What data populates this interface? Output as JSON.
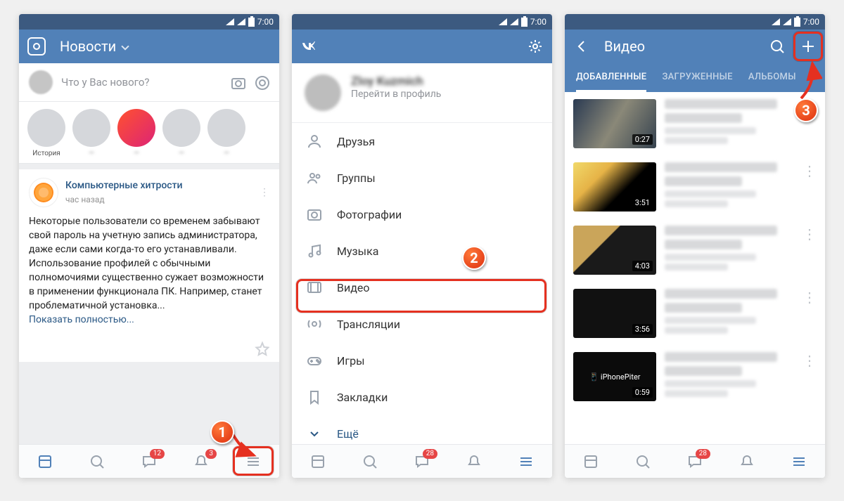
{
  "status": {
    "time": "7:00"
  },
  "screen1": {
    "title": "Новости",
    "compose_placeholder": "Что у Вас нового?",
    "story_label_0": "История",
    "post": {
      "author": "Компьютерные хитрости",
      "time": "час назад",
      "body": "Некоторые пользователи со временем забывают свой пароль на учетную запись администратора, даже если сами когда-то его устанавливали. Использование профилей с обычными полномочиями существенно сужает возможности в применении функционала ПК. Например, станет проблематичной установка...",
      "more": "Показать полностью..."
    },
    "badges": {
      "messages": "12",
      "notifications": "3"
    }
  },
  "screen2": {
    "profile_sub": "Перейти в профиль",
    "menu": {
      "friends": "Друзья",
      "groups": "Группы",
      "photos": "Фотографии",
      "music": "Музыка",
      "video": "Видео",
      "live": "Трансляции",
      "games": "Игры",
      "bookmarks": "Закладки",
      "more": "Ещё"
    },
    "badges": {
      "messages": "28"
    }
  },
  "screen3": {
    "title": "Видео",
    "tabs": {
      "added": "ДОБАВЛЕННЫЕ",
      "uploaded": "ЗАГРУЖЕННЫЕ",
      "albums": "АЛЬБОМЫ"
    },
    "videos": [
      {
        "duration": "0:27"
      },
      {
        "duration": "3:51"
      },
      {
        "duration": "4:03"
      },
      {
        "duration": "3:56"
      },
      {
        "duration": "0:59",
        "overlay": "iPhonePiter"
      }
    ],
    "badges": {
      "messages": "28"
    }
  },
  "callouts": {
    "step1": "1",
    "step2": "2",
    "step3": "3"
  }
}
